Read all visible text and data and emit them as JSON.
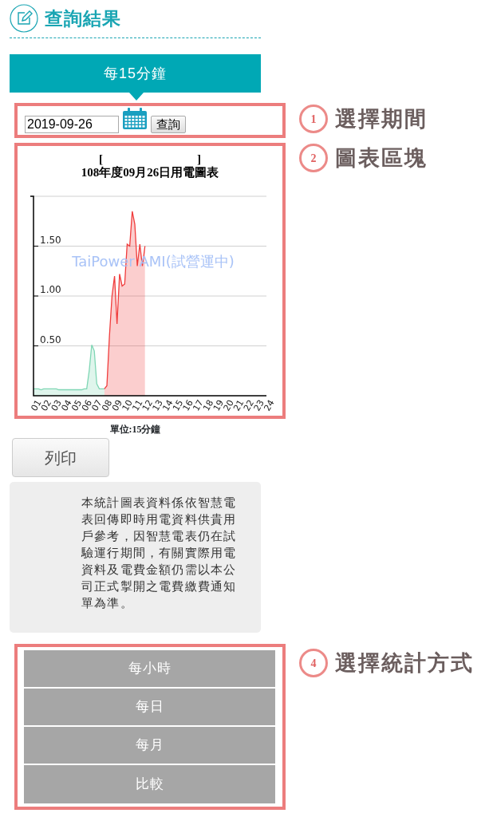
{
  "header": {
    "title": "查詢結果"
  },
  "interval_banner": {
    "label": "每15分鐘"
  },
  "query": {
    "date": "2019-09-26",
    "button": "查詢"
  },
  "chart": {
    "bracket_open": "[",
    "bracket_close": "]",
    "unit": "單位:15分鐘",
    "chart_data": {
      "type": "area",
      "title": "108年度09月26日用電圖表",
      "x": [
        1,
        1.25,
        1.5,
        1.75,
        2,
        2.25,
        2.5,
        2.75,
        3,
        3.25,
        3.5,
        3.75,
        4,
        4.25,
        4.5,
        4.75,
        5,
        5.25,
        5.5,
        5.75,
        6,
        6.25,
        6.5,
        6.75,
        7,
        7.25,
        7.5,
        7.75,
        8,
        8.25,
        8.5,
        8.75,
        9,
        9.25,
        9.5,
        9.75,
        10,
        10.25,
        10.5,
        10.75,
        11,
        11.25,
        11.5,
        11.75,
        12
      ],
      "series": [
        {
          "color": "#7fd6b4",
          "values": [
            0.07,
            0.07,
            0.07,
            0.06,
            0.07,
            0.07,
            0.07,
            0.07,
            0.07,
            0.07,
            0.06,
            0.06,
            0.06,
            0.06,
            0.06,
            0.06,
            0.06,
            0.06,
            0.06,
            0.06,
            0.07,
            0.07,
            0.25,
            0.51,
            0.45,
            0.12,
            0.07,
            0.07,
            0.07,
            null,
            null,
            null,
            null,
            null,
            null,
            null,
            null,
            null,
            null,
            null,
            null,
            null,
            null,
            null,
            null
          ]
        },
        {
          "color": "#f03c3c",
          "values": [
            null,
            null,
            null,
            null,
            null,
            null,
            null,
            null,
            null,
            null,
            null,
            null,
            null,
            null,
            null,
            null,
            null,
            null,
            null,
            null,
            null,
            null,
            null,
            null,
            null,
            null,
            null,
            null,
            0.07,
            0.1,
            0.6,
            1.0,
            1.2,
            0.72,
            1.22,
            1.1,
            1.12,
            1.52,
            1.5,
            1.85,
            1.72,
            1.3,
            1.52,
            1.3,
            1.5
          ]
        }
      ],
      "xlim": [
        1,
        24
      ],
      "ylim": [
        0,
        2
      ],
      "xticks": [
        {
          "value": 1,
          "label": "01"
        },
        {
          "value": 2,
          "label": "02"
        },
        {
          "value": 3,
          "label": "03"
        },
        {
          "value": 4,
          "label": "04"
        },
        {
          "value": 5,
          "label": "05"
        },
        {
          "value": 6,
          "label": "06"
        },
        {
          "value": 7,
          "label": "07"
        },
        {
          "value": 8,
          "label": "08"
        },
        {
          "value": 9,
          "label": "09"
        },
        {
          "value": 10,
          "label": "10"
        },
        {
          "value": 11,
          "label": "11"
        },
        {
          "value": 12,
          "label": "12"
        },
        {
          "value": 13,
          "label": "13"
        },
        {
          "value": 14,
          "label": "14"
        },
        {
          "value": 15,
          "label": "15"
        },
        {
          "value": 16,
          "label": "16"
        },
        {
          "value": 17,
          "label": "17"
        },
        {
          "value": 18,
          "label": "18"
        },
        {
          "value": 19,
          "label": "19"
        },
        {
          "value": 20,
          "label": "20"
        },
        {
          "value": 21,
          "label": "21"
        },
        {
          "value": 22,
          "label": "22"
        },
        {
          "value": 23,
          "label": "23"
        },
        {
          "value": 24,
          "label": "24"
        }
      ],
      "yticks": [
        {
          "value": 0.5,
          "label": "0.50"
        },
        {
          "value": 1,
          "label": "1.00"
        },
        {
          "value": 1.5,
          "label": "1.50"
        }
      ],
      "grid": true,
      "annotations": [
        "TaiPower AMI(試營運中)"
      ]
    }
  },
  "print_button": "列印",
  "notice": "本統計圖表資料係依智慧電表回傳即時用電資料供貴用戶參考，因智慧電表仍在試驗運行期間，有關實際用電資料及電費金額仍需以本公司正式掣開之電費繳費通知單為準。",
  "period_options": [
    {
      "label": "每小時"
    },
    {
      "label": "每日"
    },
    {
      "label": "每月"
    },
    {
      "label": "比較"
    }
  ],
  "callouts": [
    {
      "number": "1",
      "label": "選擇期間"
    },
    {
      "number": "2",
      "label": "圖表區塊"
    },
    {
      "number": "4",
      "label": "選擇統計方式"
    }
  ]
}
